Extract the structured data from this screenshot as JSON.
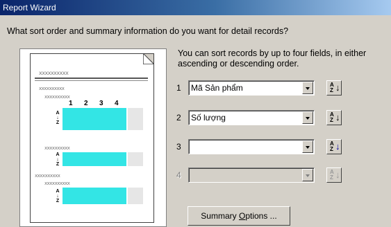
{
  "window": {
    "title": "Report Wizard"
  },
  "question": "What sort order and summary information do you want for detail records?",
  "instructions": "You can sort records by up to four fields, in either ascending or descending order.",
  "preview": {
    "placeholder": "xxxxxxxxxx",
    "placeholder_short": "xxxx",
    "column_numbers": [
      "1",
      "2",
      "3",
      "4"
    ],
    "sort_letters": [
      "A",
      "Z"
    ]
  },
  "sort_fields": [
    {
      "number": "1",
      "value": "Mã Sản phẩm",
      "enabled": true
    },
    {
      "number": "2",
      "value": "Số lượng",
      "enabled": true
    },
    {
      "number": "3",
      "value": "",
      "enabled": true
    },
    {
      "number": "4",
      "value": "",
      "enabled": false
    }
  ],
  "sort_button": {
    "a": "A",
    "z": "Z",
    "arrow": "↓"
  },
  "summary_button": {
    "label_pre": "Summary ",
    "label_hot": "O",
    "label_post": "ptions ..."
  },
  "colors": {
    "title_start": "#0a246a",
    "title_end": "#a6caf0",
    "cyan": "#33e5e5",
    "face": "#d4d0c8"
  }
}
